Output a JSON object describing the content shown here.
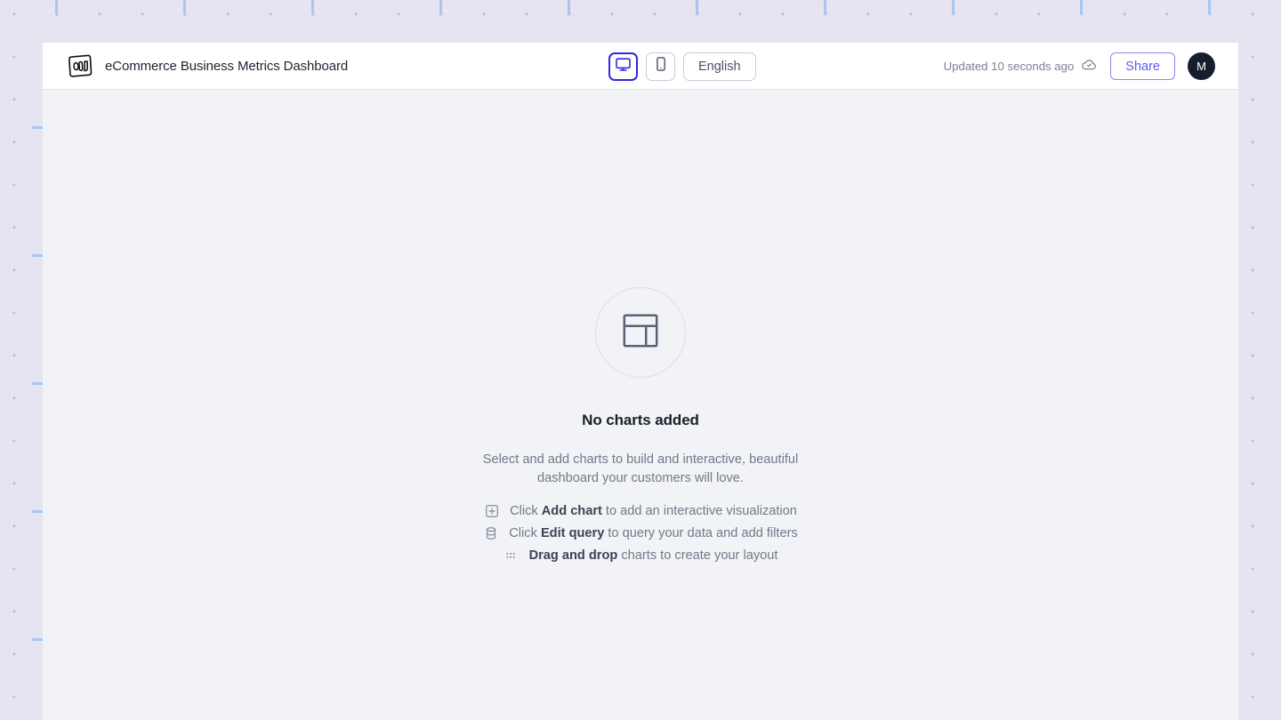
{
  "app": {
    "logo_icon": "bar-chart-logo-icon",
    "title": "eCommerce Business Metrics Dashboard"
  },
  "header": {
    "view_toggle": {
      "desktop": {
        "icon": "desktop-monitor-icon",
        "label": "Desktop",
        "selected": true
      },
      "mobile": {
        "icon": "mobile-phone-icon",
        "label": "Mobile",
        "selected": false
      }
    },
    "language": {
      "label": "English",
      "icon": "language-select"
    },
    "status": {
      "text": "Updated 10 seconds ago",
      "icon": "cloud-check-icon"
    },
    "share_label": "Share",
    "avatar_initial": "M"
  },
  "empty_state": {
    "icon": "dashboard-layout-icon",
    "title": "No charts added",
    "subtitle": "Select and add charts to build and interactive, beautiful dashboard your customers will love.",
    "hints": [
      {
        "icon": "plus-square-icon",
        "prefix": "Click ",
        "bold": "Add chart",
        "suffix": " to add an interactive visualization"
      },
      {
        "icon": "database-icon",
        "prefix": "Click ",
        "bold": "Edit query",
        "suffix": " to query your data and add filters"
      },
      {
        "icon": "drag-handle-icon",
        "prefix": "",
        "bold": "Drag and drop",
        "suffix": " charts to create your layout"
      }
    ]
  },
  "colors": {
    "backdrop": "#e6e4f1",
    "grid_dot": "#a9c5f2",
    "canvas": "#f2f3f6",
    "accent_indigo": "#615bf0",
    "active_blue": "#2a2ae0",
    "avatar_bg": "#161d2e",
    "muted_text": "#72788a"
  }
}
